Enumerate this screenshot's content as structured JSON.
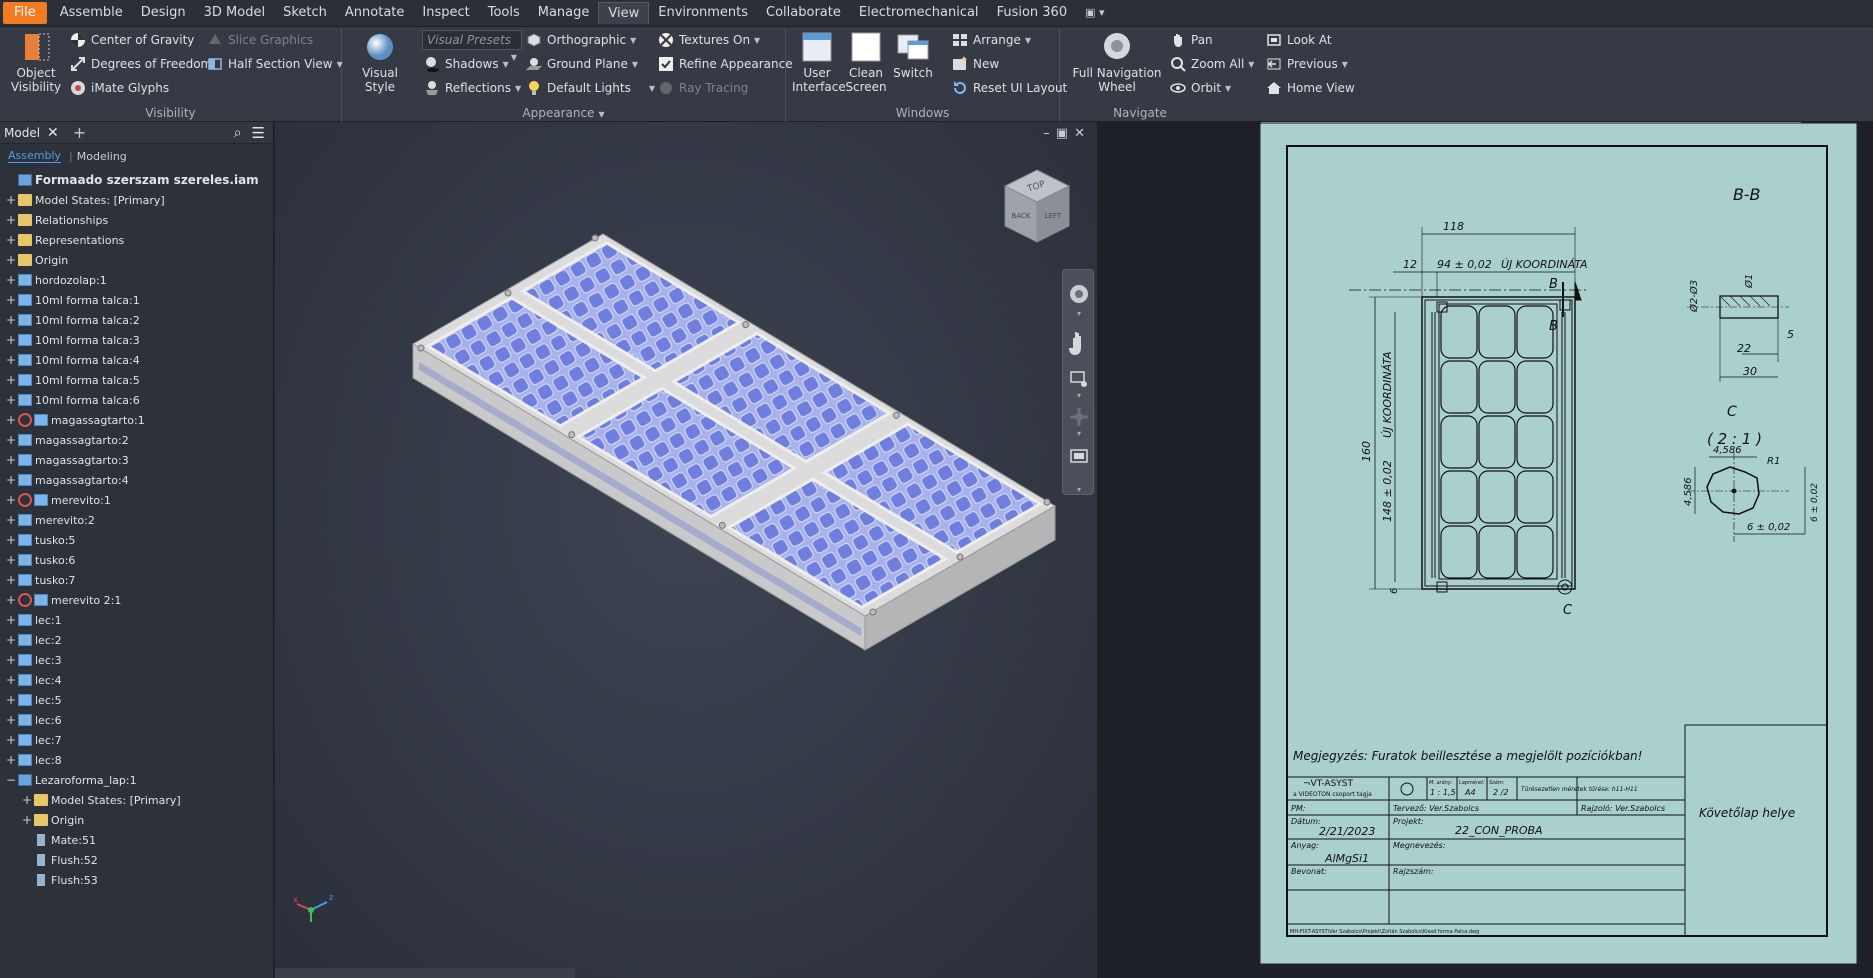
{
  "menubar": {
    "items": [
      "File",
      "Assemble",
      "Design",
      "3D Model",
      "Sketch",
      "Annotate",
      "Inspect",
      "Tools",
      "Manage",
      "View",
      "Environments",
      "Collaborate",
      "Electromechanical",
      "Fusion 360"
    ],
    "active": "View"
  },
  "ribbon": {
    "visibility": {
      "title": "Visibility",
      "object_visibility": "Object Visibility",
      "center_of_gravity": "Center of Gravity",
      "degrees_of_freedom": "Degrees of Freedom",
      "imate_glyphs": "iMate Glyphs",
      "slice_graphics": "Slice Graphics",
      "half_section_view": "Half Section View"
    },
    "appearance": {
      "title": "Appearance",
      "visual_style": "Visual Style",
      "visual_presets": "Visual Presets",
      "shadows": "Shadows",
      "reflections": "Reflections",
      "orthographic": "Orthographic",
      "ground_plane": "Ground Plane",
      "default_lights": "Default Lights",
      "textures_on": "Textures On",
      "refine_appearance": "Refine Appearance",
      "ray_tracing": "Ray Tracing"
    },
    "windows": {
      "title": "Windows",
      "user_interface": "User Interface",
      "clean_screen": "Clean Screen",
      "switch": "Switch",
      "arrange": "Arrange",
      "new": "New",
      "reset_ui_layout": "Reset UI Layout"
    },
    "navigate": {
      "title": "Navigate",
      "full_navigation_wheel": "Full Navigation Wheel",
      "pan": "Pan",
      "zoom_all": "Zoom All",
      "orbit": "Orbit",
      "look_at": "Look At",
      "previous": "Previous",
      "home_view": "Home View"
    }
  },
  "browser": {
    "tab_label": "Model",
    "tabs": [
      "Assembly",
      "Modeling"
    ],
    "items": [
      {
        "label": "Formaado szerszam szereles.iam",
        "indent": 0,
        "icon": "asm",
        "exp": "",
        "root": true
      },
      {
        "label": "Model States: [Primary]",
        "indent": 0,
        "icon": "fold",
        "exp": "+"
      },
      {
        "label": "Relationships",
        "indent": 0,
        "icon": "fold",
        "exp": "+"
      },
      {
        "label": "Representations",
        "indent": 0,
        "icon": "fold",
        "exp": "+"
      },
      {
        "label": "Origin",
        "indent": 0,
        "icon": "fold",
        "exp": "+"
      },
      {
        "label": "hordozolap:1",
        "indent": 0,
        "icon": "part",
        "exp": "+"
      },
      {
        "label": "10ml forma talca:1",
        "indent": 0,
        "icon": "part",
        "exp": "+"
      },
      {
        "label": "10ml forma talca:2",
        "indent": 0,
        "icon": "part",
        "exp": "+"
      },
      {
        "label": "10ml forma talca:3",
        "indent": 0,
        "icon": "part",
        "exp": "+"
      },
      {
        "label": "10ml forma talca:4",
        "indent": 0,
        "icon": "part",
        "exp": "+"
      },
      {
        "label": "10ml forma talca:5",
        "indent": 0,
        "icon": "part",
        "exp": "+"
      },
      {
        "label": "10ml forma talca:6",
        "indent": 0,
        "icon": "part",
        "exp": "+"
      },
      {
        "label": "magassagtarto:1",
        "indent": 0,
        "icon": "part",
        "exp": "+",
        "adaptive": true
      },
      {
        "label": "magassagtarto:2",
        "indent": 0,
        "icon": "part",
        "exp": "+"
      },
      {
        "label": "magassagtarto:3",
        "indent": 0,
        "icon": "part",
        "exp": "+"
      },
      {
        "label": "magassagtarto:4",
        "indent": 0,
        "icon": "part",
        "exp": "+"
      },
      {
        "label": "merevito:1",
        "indent": 0,
        "icon": "part",
        "exp": "+",
        "adaptive": true
      },
      {
        "label": "merevito:2",
        "indent": 0,
        "icon": "part",
        "exp": "+"
      },
      {
        "label": "tusko:5",
        "indent": 0,
        "icon": "part",
        "exp": "+"
      },
      {
        "label": "tusko:6",
        "indent": 0,
        "icon": "part",
        "exp": "+"
      },
      {
        "label": "tusko:7",
        "indent": 0,
        "icon": "part",
        "exp": "+"
      },
      {
        "label": "merevito 2:1",
        "indent": 0,
        "icon": "part",
        "exp": "+",
        "adaptive": true
      },
      {
        "label": "lec:1",
        "indent": 0,
        "icon": "part",
        "exp": "+"
      },
      {
        "label": "lec:2",
        "indent": 0,
        "icon": "part",
        "exp": "+"
      },
      {
        "label": "lec:3",
        "indent": 0,
        "icon": "part",
        "exp": "+"
      },
      {
        "label": "lec:4",
        "indent": 0,
        "icon": "part",
        "exp": "+"
      },
      {
        "label": "lec:5",
        "indent": 0,
        "icon": "part",
        "exp": "+"
      },
      {
        "label": "lec:6",
        "indent": 0,
        "icon": "part",
        "exp": "+"
      },
      {
        "label": "lec:7",
        "indent": 0,
        "icon": "part",
        "exp": "+"
      },
      {
        "label": "lec:8",
        "indent": 0,
        "icon": "part",
        "exp": "+"
      },
      {
        "label": "Lezaroforma_lap:1",
        "indent": 0,
        "icon": "asm",
        "exp": "−"
      },
      {
        "label": "Model States: [Primary]",
        "indent": 1,
        "icon": "fold",
        "exp": "+"
      },
      {
        "label": "Origin",
        "indent": 1,
        "icon": "fold",
        "exp": "+"
      },
      {
        "label": "Mate:51",
        "indent": 1,
        "icon": "cons",
        "exp": ""
      },
      {
        "label": "Flush:52",
        "indent": 1,
        "icon": "cons",
        "exp": ""
      },
      {
        "label": "Flush:53",
        "indent": 1,
        "icon": "cons",
        "exp": ""
      }
    ]
  },
  "viewcube": {
    "top": "TOP",
    "front": "BACK",
    "right": "LEFT"
  },
  "drawing": {
    "section_title": "B-B",
    "detail_title": "C",
    "detail_scale": "( 2 : 1 )",
    "dims": {
      "d118": "118",
      "d12": "12",
      "d94": "94 ± 0,02",
      "ujkoord_top": "ÚJ KOORDINÁTA",
      "d160": "160",
      "d148": "148 ± 0,02",
      "ujkoord_side": "ÚJ KOORDINÁTA",
      "d6": "6",
      "phi2_3": "Ø2-Ø3",
      "phi1": "Ø1",
      "d5": "5",
      "d22": "22",
      "d30": "30",
      "d4586a": "4,586",
      "d4586b": "4,586",
      "r1": "R1",
      "d6b": "6 ± 0,02",
      "d6c": "6 ± 0,02"
    },
    "cut_label": "B",
    "cut_label2": "B",
    "detail_marker": "C",
    "note": "Megjegyzés: Furatok beillesztése a megjelölt pozíciókban!",
    "title_block": {
      "company": "¬VT-ASYST",
      "company_sub": "a VIDEOTON csoport tagja",
      "meretarany_label": "M. arány:",
      "meretarany": "1 : 1,5",
      "lapmeret_label": "Lapméret:",
      "lapmeret": "A4",
      "szam_label": "Szám:",
      "szam": "2 /2",
      "tures": "Tűrésezetlen méretek tűrése: h11-H11",
      "pm": "PM:",
      "tervezo": "Tervező: Ver.Szabolcs",
      "rajzolo": "Rajzoló: Ver.Szabolcs",
      "datum_label": "Dátum:",
      "datum": "2/21/2023",
      "projekt_label": "Projekt:",
      "projekt": "22_CON_PROBA",
      "anyag_label": "Anyag:",
      "anyag": "AlMgSi1",
      "megnevezes_label": "Megnevezés:",
      "bevonat_label": "Bevonat:",
      "rajzszam_label": "Rajzszám:",
      "side_note": "Követőlap helye",
      "path": "MH-FIXT-ASYST\\Ver Szabolcs\\Projekt\\Zoltán Szabolcs\\Kiesd forma Palca.dwg"
    }
  }
}
